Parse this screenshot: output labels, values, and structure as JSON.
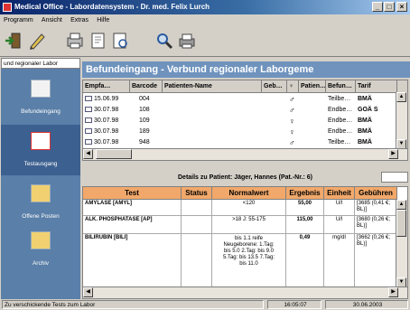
{
  "window": {
    "title": "Medical Office - Labordatensystem - Dr. med. Felix Lurch",
    "controls": [
      "_",
      "□",
      "×"
    ]
  },
  "menu": [
    "Programm",
    "Ansicht",
    "Extras",
    "Hilfe"
  ],
  "toolbar": {
    "icons": [
      "exit-icon",
      "edit-icon",
      "print-icon",
      "document-search-icon",
      "magnifier-icon",
      "printer-icon"
    ]
  },
  "sidebar": {
    "tab_label": "und regionaler Labor",
    "items": [
      {
        "label": "Befundeingang",
        "icon": "inbox-icon"
      },
      {
        "label": "Testausgang",
        "icon": "outbox-icon"
      },
      {
        "label": "Offene Posten",
        "icon": "open-items-icon"
      },
      {
        "label": "Archiv",
        "icon": "archive-icon"
      }
    ]
  },
  "header": {
    "title": "Befundeingang - Verbund regionaler Laborgeme"
  },
  "results_table": {
    "columns": [
      "Empfa…",
      "Barcode",
      "Patienten-Name",
      "Geb…",
      "♀",
      "Patien…",
      "Befun…",
      "Tarif"
    ],
    "rows": [
      {
        "date": "15.06.99",
        "barcode": "004",
        "name": "",
        "geb": "",
        "gender": "♂",
        "patient": "",
        "befund": "Teilbe…",
        "tarif": "BMÄ"
      },
      {
        "date": "30.07.98",
        "barcode": "108",
        "name": "",
        "geb": "",
        "gender": "♂",
        "patient": "",
        "befund": "Endbe…",
        "tarif": "GOÄ S"
      },
      {
        "date": "30.07.98",
        "barcode": "109",
        "name": "",
        "geb": "",
        "gender": "♀",
        "patient": "",
        "befund": "Endbe…",
        "tarif": "BMÄ"
      },
      {
        "date": "30.07.98",
        "barcode": "189",
        "name": "",
        "geb": "",
        "gender": "♀",
        "patient": "",
        "befund": "Endbe…",
        "tarif": "BMÄ"
      },
      {
        "date": "30.07.98",
        "barcode": "948",
        "name": "",
        "geb": "",
        "gender": "♂",
        "patient": "",
        "befund": "Teilbe…",
        "tarif": "BMÄ"
      }
    ]
  },
  "details": {
    "label": "Details zu Patient: Jäger, Hannes (Pat.-Nr.: 6)"
  },
  "tests_table": {
    "columns": [
      "Test",
      "Status",
      "Normalwert",
      "Ergebnis",
      "Einheit",
      "Gebühren"
    ],
    "rows": [
      {
        "test": "AMYLASE [AMYL]",
        "status": "",
        "normal": "<120",
        "result": "55,00",
        "unit": "U/l",
        "fee": "[3685 (0,41 €; BL)]"
      },
      {
        "test": "ALK. PHOSPHATASE [AP]",
        "status": "",
        "normal": ">18 J: 55-175",
        "result": "115,00",
        "unit": "U/l",
        "fee": "[3680 (0,26 €; BL)]"
      },
      {
        "test": "BILIRUBIN [BILI]",
        "status": "",
        "normal": "bis 1.1 reife Neugeborene: 1.Tag: bis 5.0 2.Tag: bis 9.0 5.Tag: bis 13.5 7.Tag: bis 11.0",
        "result": "0,49",
        "unit": "mg/dl",
        "fee": "[3662 (0,26 €; BL)]"
      }
    ]
  },
  "statusbar": {
    "message": "Zu verschickende Tests zum Labor",
    "time": "16:05:07",
    "date": "30.06.2003"
  },
  "colors": {
    "sidebar": "#5a7fa8",
    "header": "#6f93bd",
    "table_header": "#f1a86a"
  }
}
